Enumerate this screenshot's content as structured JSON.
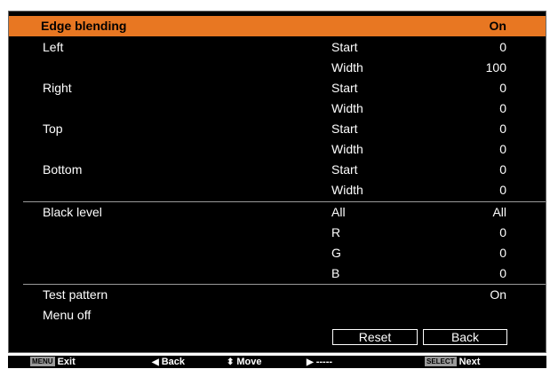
{
  "menu": {
    "selected": {
      "label": "Edge blending",
      "value": "On"
    },
    "rows": [
      {
        "label": "Left",
        "sub": "Start",
        "value": "0"
      },
      {
        "label": "",
        "sub": "Width",
        "value": "100"
      },
      {
        "label": "Right",
        "sub": "Start",
        "value": "0"
      },
      {
        "label": "",
        "sub": "Width",
        "value": "0"
      },
      {
        "label": "Top",
        "sub": "Start",
        "value": "0"
      },
      {
        "label": "",
        "sub": "Width",
        "value": "0"
      },
      {
        "label": "Bottom",
        "sub": "Start",
        "value": "0"
      },
      {
        "label": "",
        "sub": "Width",
        "value": "0"
      },
      {
        "label": "Black level",
        "sub": "All",
        "value": "All"
      },
      {
        "label": "",
        "sub": "R",
        "value": "0"
      },
      {
        "label": "",
        "sub": "G",
        "value": "0"
      },
      {
        "label": "",
        "sub": "B",
        "value": "0"
      },
      {
        "label": "Test pattern",
        "sub": "",
        "value": "On"
      },
      {
        "label": "Menu off",
        "sub": "",
        "value": ""
      }
    ],
    "buttons": {
      "reset": "Reset",
      "back": "Back"
    }
  },
  "footer": {
    "menu_key": "MENU",
    "exit": "Exit",
    "back": "Back",
    "move": "Move",
    "next_blank": "-----",
    "select_key": "SELECT",
    "next": "Next"
  },
  "colors": {
    "highlight": "#e87722",
    "background": "#000000",
    "text": "#ffffff"
  }
}
